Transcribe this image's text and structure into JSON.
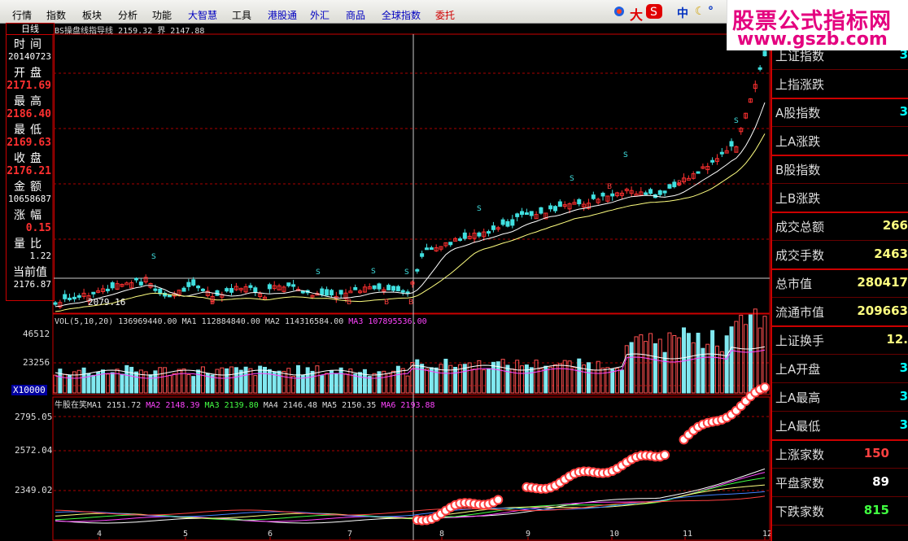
{
  "menu": {
    "items": [
      {
        "label": "行情",
        "style": "normal"
      },
      {
        "label": "指数",
        "style": "normal"
      },
      {
        "label": "板块",
        "style": "normal"
      },
      {
        "label": "分析",
        "style": "normal"
      },
      {
        "label": "功能",
        "style": "normal"
      },
      {
        "label": "大智慧",
        "style": "blue"
      },
      {
        "label": "工具",
        "style": "normal"
      },
      {
        "label": "港股通",
        "style": "blue"
      },
      {
        "label": "外汇",
        "style": "blue"
      },
      {
        "label": "商品",
        "style": "blue"
      },
      {
        "label": "全球指数",
        "style": "blue"
      },
      {
        "label": "委托",
        "style": "red"
      }
    ],
    "brand_big": "大",
    "brand_mid": "中"
  },
  "watermark": {
    "line1": "股票公式指标网",
    "line2": "www.gszb.com"
  },
  "left_panel": {
    "tab": "日线",
    "fields": [
      {
        "label": "时间",
        "value": "20140723",
        "color": "#ffffff"
      },
      {
        "label": "开盘",
        "value": "2171.69",
        "color": "#ff3030"
      },
      {
        "label": "最高",
        "value": "2186.40",
        "color": "#ff3030"
      },
      {
        "label": "最低",
        "value": "2169.63",
        "color": "#ff3030"
      },
      {
        "label": "收盘",
        "value": "2176.21",
        "color": "#ff3030"
      },
      {
        "label": "金额",
        "value": "10658687",
        "color": "#ffffff"
      },
      {
        "label": "涨幅",
        "value": "0.15",
        "color": "#ff3030"
      },
      {
        "label": "量比",
        "value": "1.22",
        "color": "#ffffff"
      },
      {
        "label": "当前值",
        "value": "2176.87",
        "color": "#ffffff"
      }
    ]
  },
  "main_chart": {
    "title": "BS操盘线指导线",
    "v1": "2159.32",
    "label2": "界",
    "v2": "2147.88",
    "low_label": "2079.16"
  },
  "vol_chart": {
    "header": "VOL(5,10,20)",
    "vol": "136969440.00",
    "ma1": "MA1 112884840.00",
    "ma2": "MA2 114316584.00",
    "ma3": "MA3 107895536.00",
    "y1": "46512",
    "y2": "23256",
    "unit": "X10000"
  },
  "ind_chart": {
    "name": "牛股在笑",
    "ma1": "MA1 2151.72",
    "ma2": "MA2 2148.39",
    "ma3": "MA3 2139.80",
    "ma4": "MA4 2146.48",
    "ma5": "MA5 2150.35",
    "ma6": "MA6 2193.88",
    "y1": "2795.05",
    "y2": "2572.04",
    "y3": "2349.02"
  },
  "x_axis": [
    "4",
    "5",
    "6",
    "7",
    "8",
    "9",
    "10",
    "11",
    "12"
  ],
  "right_panel": [
    {
      "label": "上证指数",
      "value": "3",
      "color": "#00ffff",
      "sep": false
    },
    {
      "label": "上指涨跌",
      "value": "",
      "color": "#00ffff",
      "sep": true
    },
    {
      "label": "A股指数",
      "value": "3",
      "color": "#00ffff",
      "sep": false
    },
    {
      "label": "上A涨跌",
      "value": "",
      "color": "#00ffff",
      "sep": true
    },
    {
      "label": "B股指数",
      "value": "",
      "color": "#00ffff",
      "sep": false
    },
    {
      "label": "上B涨跌",
      "value": "",
      "color": "#00ffff",
      "sep": true
    },
    {
      "label": "成交总额",
      "value": "266",
      "color": "#ffff80",
      "sep": false
    },
    {
      "label": "成交手数",
      "value": "2463",
      "color": "#ffff80",
      "sep": true
    },
    {
      "label": "总市值",
      "value": "280417",
      "color": "#ffff80",
      "sep": false
    },
    {
      "label": "流通市值",
      "value": "209663",
      "color": "#ffff80",
      "sep": true
    },
    {
      "label": "上证换手",
      "value": "12.",
      "color": "#ffff80",
      "sep": false
    },
    {
      "label": "上A开盘",
      "value": "3",
      "color": "#00ffff",
      "sep": false
    },
    {
      "label": "上A最高",
      "value": "3",
      "color": "#00ffff",
      "sep": false
    },
    {
      "label": "上A最低",
      "value": "3",
      "color": "#00ffff",
      "sep": true
    },
    {
      "label": "上涨家数",
      "value": "150",
      "color": "#ff4040",
      "sep": false
    },
    {
      "label": "平盘家数",
      "value": "89",
      "color": "#ffffff",
      "sep": false
    },
    {
      "label": "下跌家数",
      "value": "815",
      "color": "#40ff40",
      "sep": false
    }
  ]
}
